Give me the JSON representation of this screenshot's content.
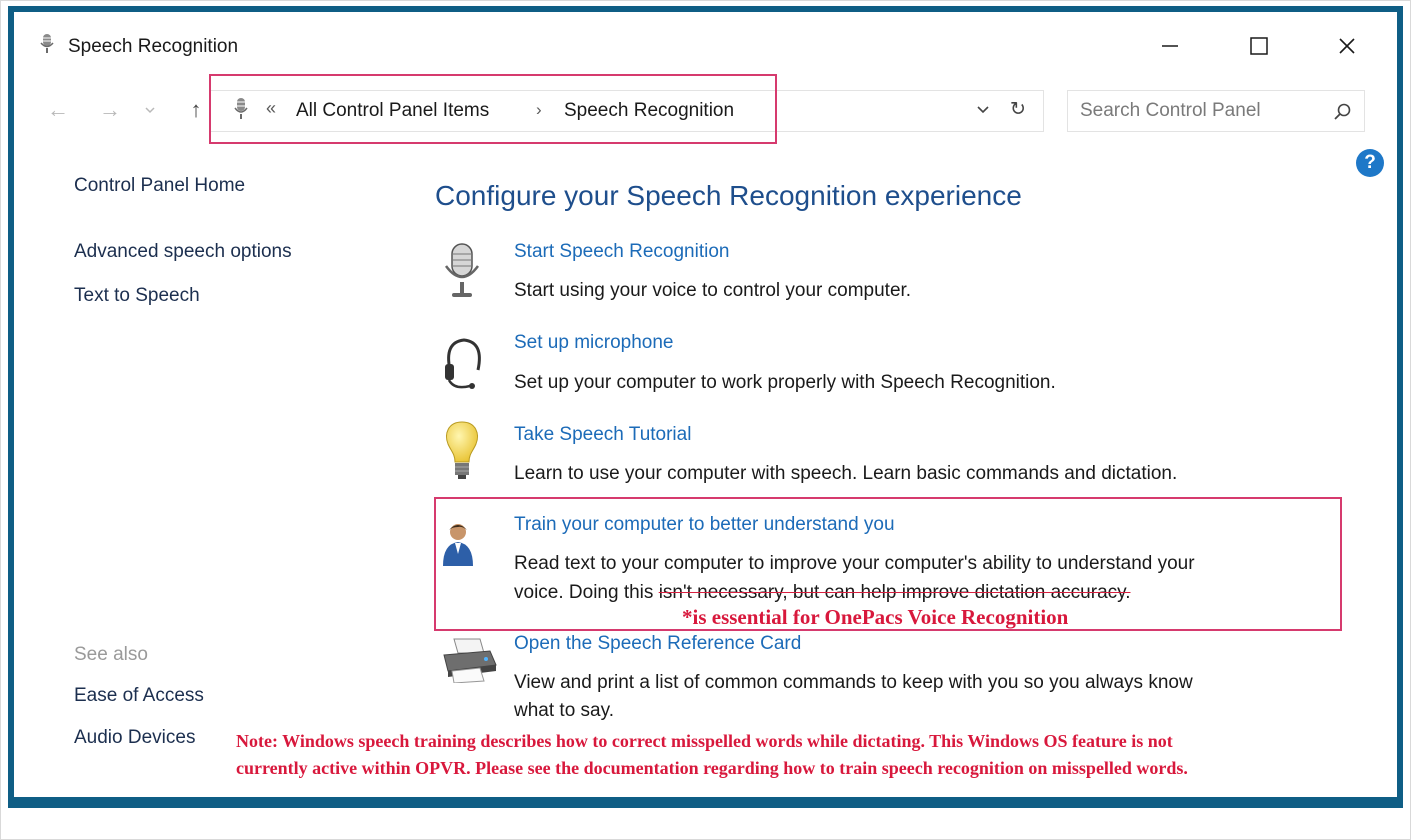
{
  "window": {
    "title": "Speech Recognition",
    "minimize_label": "—",
    "maximize_label": "☐",
    "close_label": "✕"
  },
  "nav": {
    "back": "←",
    "forward": "→",
    "recent": "⌄",
    "up": "↑"
  },
  "address": {
    "chevron": "«",
    "crumbs": [
      "All Control Panel Items",
      "Speech Recognition"
    ],
    "separator": "›",
    "dropdown": "⌄",
    "refresh": "↻",
    "icon": "microphone-icon"
  },
  "search": {
    "placeholder": "Search Control Panel",
    "icon": "search-icon"
  },
  "help": {
    "label": "?"
  },
  "sidebar": {
    "items": [
      {
        "label": "Control Panel Home"
      },
      {
        "label": "Advanced speech options"
      },
      {
        "label": "Text to Speech"
      }
    ],
    "see_also_heading": "See also",
    "see_also": [
      {
        "label": "Ease of Access"
      },
      {
        "label": "Audio Devices"
      }
    ]
  },
  "main": {
    "title": "Configure your Speech Recognition experience",
    "tasks": [
      {
        "link": "Start Speech Recognition",
        "desc": "Start using your voice to control your computer.",
        "icon": "microphone-icon"
      },
      {
        "link": "Set up microphone",
        "desc": "Set up your computer to work properly with Speech Recognition.",
        "icon": "headset-icon"
      },
      {
        "link": "Take Speech Tutorial",
        "desc": "Learn to use your computer with speech.  Learn basic commands and dictation.",
        "icon": "lightbulb-icon"
      },
      {
        "link": "Train your computer to better understand you",
        "desc_line1": "Read text to your computer to improve your computer's ability to understand your",
        "desc_line2_start": "voice.  Doing this ",
        "desc_line2_struck": "isn't necessary, but can help improve dictation accuracy.",
        "icon": "user-icon"
      },
      {
        "link": "Open the Speech Reference Card",
        "desc_line1": "View and print a list of common commands to keep with you so you always know",
        "desc_line2": "what to say.",
        "icon": "printer-icon"
      }
    ]
  },
  "annotations": {
    "train_note": "*is essential for OnePacs Voice Recognition",
    "note_line1": "Note: Windows speech training describes how to correct misspelled words while dictating. This Windows OS feature  is not",
    "note_line2": "currently active within OPVR. Please see the documentation regarding how to train speech recognition on misspelled words.",
    "highlight_color": "#d63a6e",
    "note_color": "#d8183c"
  },
  "colors": {
    "frame": "#0f5e85",
    "link": "#1c6bb8",
    "title": "#1e4e8c"
  }
}
